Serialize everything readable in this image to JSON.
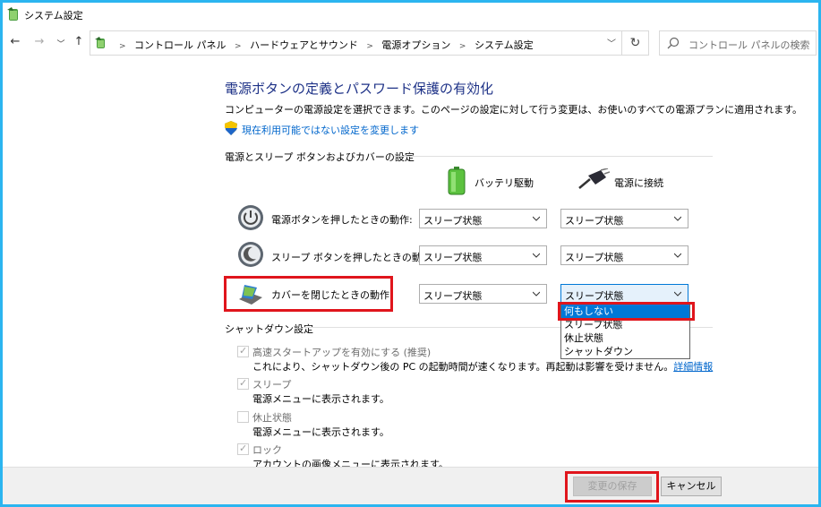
{
  "window": {
    "title": "システム設定"
  },
  "nav": {
    "breadcrumbs": [
      "コントロール パネル",
      "ハードウェアとサウンド",
      "電源オプション",
      "システム設定"
    ],
    "search_placeholder": "コントロール パネルの検索"
  },
  "page": {
    "heading": "電源ボタンの定義とパスワード保護の有効化",
    "description": "コンピューターの電源設定を選択できます。このページの設定に対して行う変更は、お使いのすべての電源プランに適用されます。",
    "change_link": "現在利用可能ではない設定を変更します"
  },
  "power_section": {
    "title": "電源とスリープ ボタンおよびカバーの設定",
    "col_battery": "バッテリ駆動",
    "col_plugged": "電源に接続",
    "rows": [
      {
        "label": "電源ボタンを押したときの動作:",
        "battery": "スリープ状態",
        "plugged": "スリープ状態"
      },
      {
        "label": "スリープ ボタンを押したときの動作:",
        "battery": "スリープ状態",
        "plugged": "スリープ状態"
      },
      {
        "label": "カバーを閉じたときの動作:",
        "battery": "スリープ状態",
        "plugged": "スリープ状態"
      }
    ],
    "dropdown_options": [
      "何もしない",
      "スリープ状態",
      "休止状態",
      "シャットダウン"
    ],
    "dropdown_highlighted": "何もしない"
  },
  "shutdown_section": {
    "title": "シャットダウン設定",
    "items": [
      {
        "label": "高速スタートアップを有効にする (推奨)",
        "checked": true,
        "desc": "これにより、シャットダウン後の PC の起動時間が速くなります。再起動は影響を受けません。",
        "more_link": "詳細情報"
      },
      {
        "label": "スリープ",
        "checked": true,
        "desc": "電源メニューに表示されます。"
      },
      {
        "label": "休止状態",
        "checked": false,
        "desc": "電源メニューに表示されます。"
      },
      {
        "label": "ロック",
        "checked": true,
        "desc": "アカウントの画像メニューに表示されます。"
      }
    ]
  },
  "footer": {
    "save_label": "変更の保存",
    "cancel_label": "キャンセル"
  },
  "colors": {
    "frame": "#2bb5f0",
    "heading": "#1e3287",
    "link": "#0066cc",
    "highlight": "#e0151c",
    "selection": "#0078d7"
  }
}
